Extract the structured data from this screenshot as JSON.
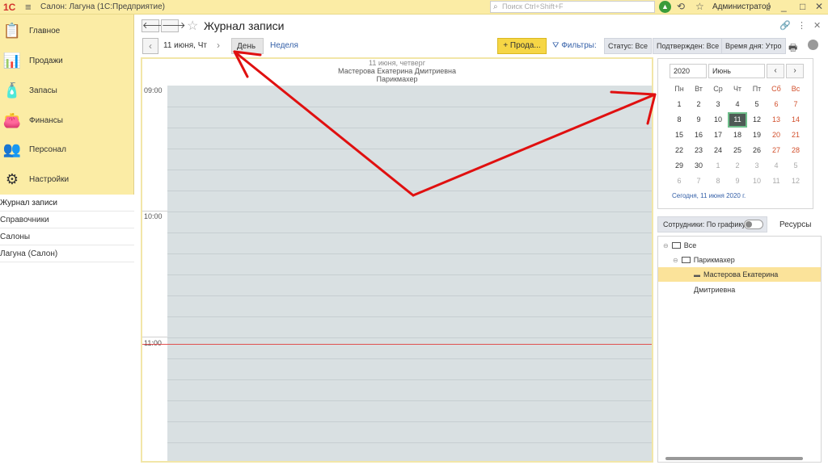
{
  "titlebar": {
    "logo": "1С",
    "title": "Салон: Лагуна  (1С:Предприятие)",
    "search_placeholder": "Поиск Ctrl+Shift+F",
    "user": "Администратор"
  },
  "sidebar": {
    "sections": [
      {
        "label": "Главное",
        "icon": "clipboard-icon"
      },
      {
        "label": "Продажи",
        "icon": "sales-chart-icon"
      },
      {
        "label": "Запасы",
        "icon": "stock-icon"
      },
      {
        "label": "Финансы",
        "icon": "wallet-icon"
      },
      {
        "label": "Персонал",
        "icon": "people-icon"
      },
      {
        "label": "Настройки",
        "icon": "gear-icon"
      }
    ],
    "links": [
      {
        "label": "Журнал записи"
      },
      {
        "label": "Справочники"
      },
      {
        "label": "Салоны"
      },
      {
        "label": "Лагуна (Салон)"
      }
    ]
  },
  "header": {
    "title": "Журнал записи"
  },
  "toolbar": {
    "date": "11 июня, Чт",
    "day": "День",
    "week": "Неделя",
    "sell": "+ Прода...",
    "filters": "Фильтры:",
    "status": "Статус: Все",
    "confirmed": "Подтвержден: Все",
    "daytime": "Время дня: Утро"
  },
  "schedule": {
    "day": "11 июня, четверг",
    "employee": "Мастерова Екатерина Дмитриевна",
    "role": "Парикмахер",
    "times": [
      "09:00",
      "10:00",
      "11:00"
    ]
  },
  "calendar": {
    "year": "2020",
    "month": "Июнь",
    "weekdays": [
      "Пн",
      "Вт",
      "Ср",
      "Чт",
      "Пт",
      "Сб",
      "Вс"
    ],
    "weeks": [
      [
        "1",
        "2",
        "3",
        "4",
        "5",
        "6",
        "7"
      ],
      [
        "8",
        "9",
        "10",
        "11",
        "12",
        "13",
        "14"
      ],
      [
        "15",
        "16",
        "17",
        "18",
        "19",
        "20",
        "21"
      ],
      [
        "22",
        "23",
        "24",
        "25",
        "26",
        "27",
        "28"
      ],
      [
        "29",
        "30",
        "1",
        "2",
        "3",
        "4",
        "5"
      ],
      [
        "6",
        "7",
        "8",
        "9",
        "10",
        "11",
        "12"
      ]
    ],
    "selected_day": "11",
    "today": "Сегодня, 11 июня 2020 г."
  },
  "staff": {
    "toggle_label": "Сотрудники: По графику",
    "resources": "Ресурсы",
    "tree": [
      {
        "label": "Все",
        "type": "folder"
      },
      {
        "label": "Парикмахер",
        "type": "folder"
      },
      {
        "label": "Мастерова Екатерина Дмитриевна",
        "type": "employee"
      }
    ]
  },
  "colors": {
    "accent_yellow": "#fbeca5",
    "sell_button": "#f6d645",
    "annotation_red": "#e01010",
    "link_blue": "#3460a8"
  }
}
